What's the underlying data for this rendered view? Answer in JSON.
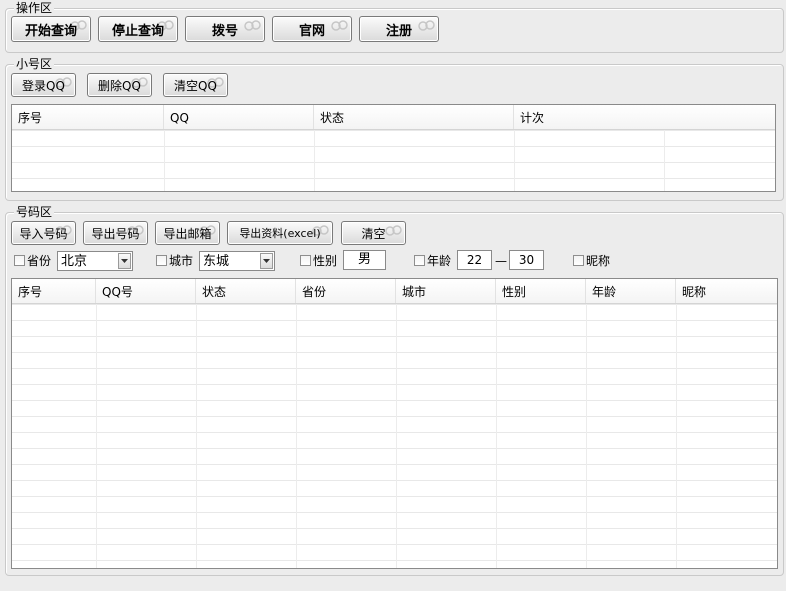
{
  "ops": {
    "title": "操作区",
    "buttons": [
      "开始查询",
      "停止查询",
      "拨号",
      "官网",
      "注册"
    ]
  },
  "accounts": {
    "title": "小号区",
    "buttons": [
      "登录QQ",
      "删除QQ",
      "清空QQ"
    ],
    "columns": [
      "序号",
      "QQ",
      "状态",
      "计次"
    ]
  },
  "numbers": {
    "title": "号码区",
    "buttons": [
      "导入号码",
      "导出号码",
      "导出邮箱",
      "导出资料(excel)",
      "清空"
    ],
    "filters": {
      "province_label": "省份",
      "province_value": "北京",
      "city_label": "城市",
      "city_value": "东城",
      "gender_label": "性别",
      "gender_value": "男",
      "age_label": "年龄",
      "age_min": "22",
      "age_sep": "—",
      "age_max": "30",
      "nickname_label": "昵称"
    },
    "columns": [
      "序号",
      "QQ号",
      "状态",
      "省份",
      "城市",
      "性别",
      "年龄",
      "昵称"
    ]
  }
}
